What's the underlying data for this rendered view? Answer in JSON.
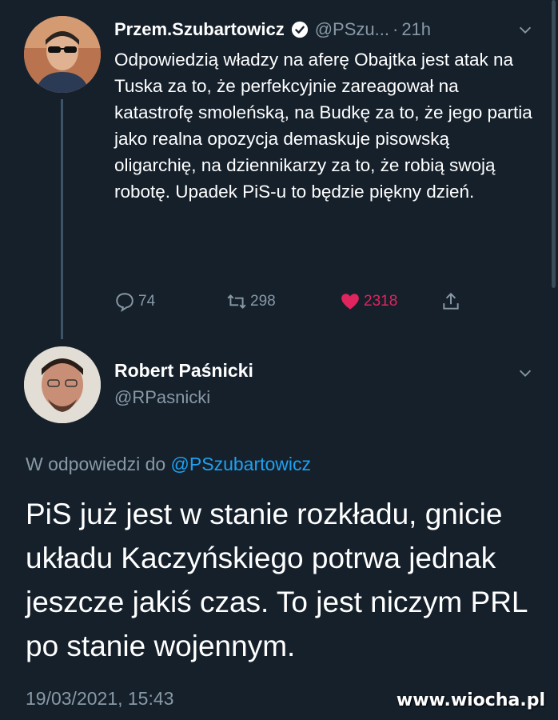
{
  "tweet": {
    "author_name": "Przem.Szubartowicz",
    "handle": "@PSzu...",
    "separator": "·",
    "time": "21h",
    "text": "Odpowiedzią władzy na aferę Obajtka jest atak na Tuska za to, że perfekcyjnie zareagował na katastrofę smoleńską, na Budkę za to, że jego partia jako realna opozycja demaskuje pisowską oligarchię, na dziennikarzy za to, że robią swoją robotę. Upadek PiS-u to będzie piękny dzień.",
    "replies": "74",
    "retweets": "298",
    "likes": "2318"
  },
  "reply": {
    "author_name": "Robert Paśnicki",
    "handle": "@RPasnicki",
    "replying_prefix": "W odpowiedzi do",
    "replying_to": "@PSzubartowicz",
    "text": "PiS już jest w stanie rozkładu, gnicie układu Kaczyńskiego potrwa jednak jeszcze jakiś czas. To jest niczym PRL po stanie wojennym.",
    "datetime": "19/03/2021, 15:43"
  },
  "watermark": "www.wiocha.pl",
  "colors": {
    "background": "#15202b",
    "secondary_text": "#8899a6",
    "link": "#1da1f2",
    "like": "#e0245e"
  }
}
